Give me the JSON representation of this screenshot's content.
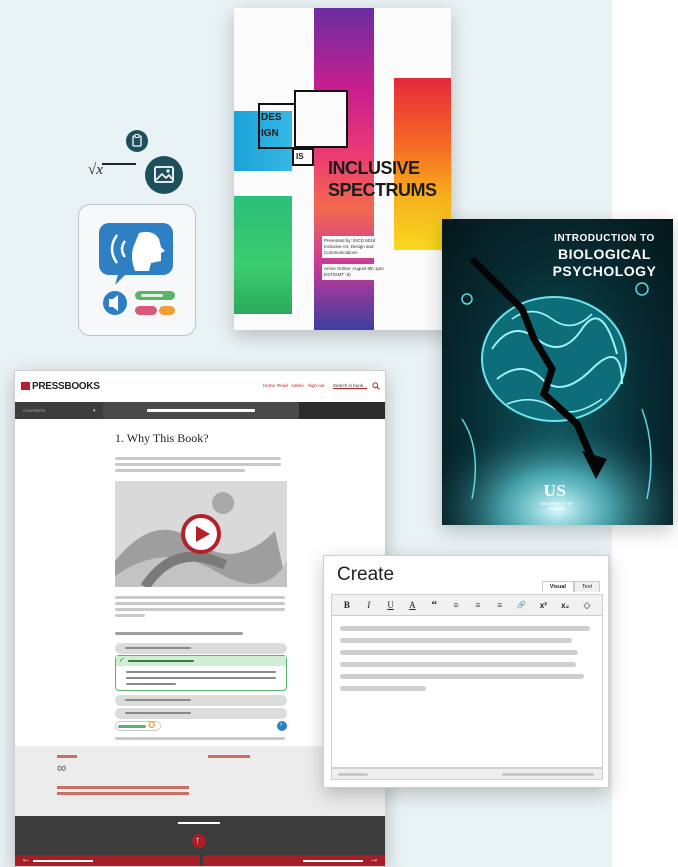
{
  "book_design": {
    "boxes": [
      "DES",
      "IGN",
      "IS"
    ],
    "title_line1": "INCLUSIVE",
    "title_line2": "SPECTRUMS",
    "presented": "Presented by: INCD 6016 Inclusive Art, Design and Communications",
    "date": "Arrive Online: August 8th 1pm EST/GMT -5)"
  },
  "book_psych": {
    "title_line1": "INTRODUCTION TO",
    "title_line2": "BIOLOGICAL",
    "title_line3": "PSYCHOLOGY",
    "logo": "US",
    "university": "UNIVERSITY OF SUSSEX"
  },
  "icons": {
    "math_formula": "√x",
    "clipboard": "clipboard-icon",
    "image": "image-icon",
    "tts": "text-to-speech-icon"
  },
  "pressbooks": {
    "brand": "PRESSBOOKS",
    "nav": [
      "Home",
      "Read",
      "Admin",
      "Sign out"
    ],
    "search_placeholder": "Search in book...",
    "toc_label": "CONTENTS",
    "chapter_title": "1.  Why This Book?",
    "footer_logo": "∞"
  },
  "editor": {
    "title": "Create",
    "tabs": [
      "Visual",
      "Text"
    ],
    "toolbar": [
      "B",
      "I",
      "U",
      "A",
      "“",
      "≡",
      "≡",
      "≡",
      "🔗",
      "x²",
      "x₂",
      "◇"
    ]
  },
  "colors": {
    "accent_red": "#b3212a",
    "teal": "#1d4f5c",
    "tts_blue": "#2f7fc4",
    "success_green": "#5ab36a"
  }
}
